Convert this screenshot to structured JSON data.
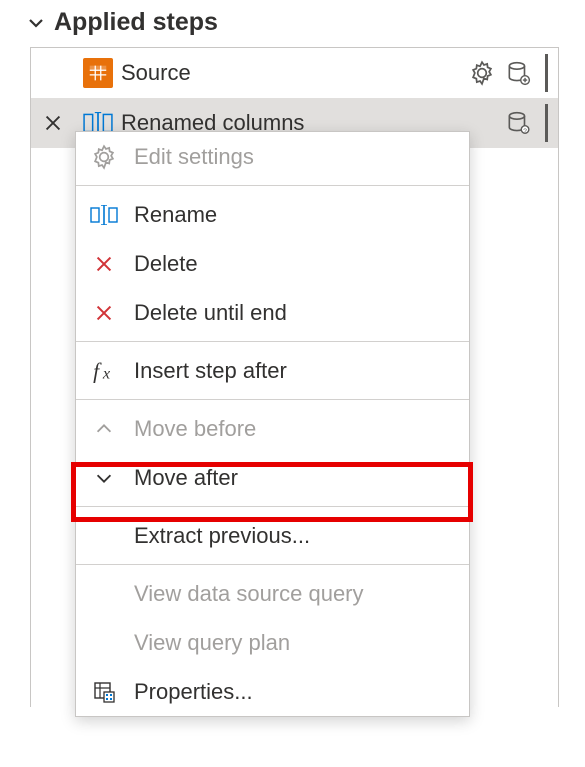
{
  "panel": {
    "title": "Applied steps"
  },
  "steps": [
    {
      "label": "Source"
    },
    {
      "label": "Renamed columns"
    }
  ],
  "menu": {
    "edit_settings": "Edit settings",
    "rename": "Rename",
    "delete": "Delete",
    "delete_until_end": "Delete until end",
    "insert_after": "Insert step after",
    "move_before": "Move before",
    "move_after": "Move after",
    "extract_previous": "Extract previous...",
    "view_data_source": "View data source query",
    "view_query_plan": "View query plan",
    "properties": "Properties..."
  },
  "highlighted_item": "move_after"
}
